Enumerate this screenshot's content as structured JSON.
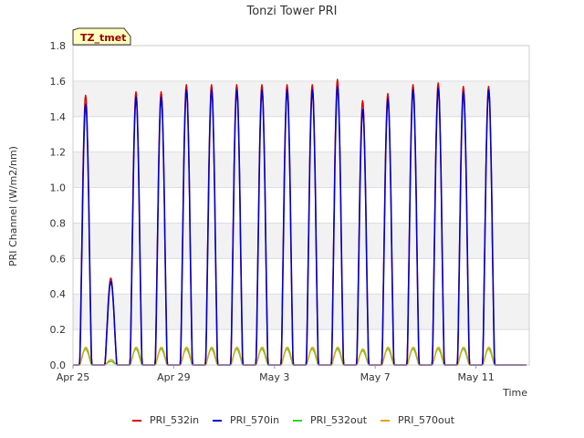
{
  "chart_data": {
    "type": "line",
    "title": "Tonzi Tower PRI",
    "xlabel": "Time",
    "ylabel": "PRI Channel (W/m2/nm)",
    "badge": "TZ_tmet",
    "ylim": [
      0,
      1.8
    ],
    "y_ticks": [
      "0.0",
      "0.2",
      "0.4",
      "0.6",
      "0.8",
      "1.0",
      "1.2",
      "1.4",
      "1.6",
      "1.8"
    ],
    "x_ticks": [
      "Apr 25",
      "Apr 29",
      "May 3",
      "May 7",
      "May 11"
    ],
    "x_start": "2024-04-25",
    "x_end": "2024-05-13",
    "legend_position": "bottom",
    "colors": {
      "PRI_532in": "#dd0000",
      "PRI_570in": "#0000cc",
      "PRI_532out": "#22dd22",
      "PRI_570out": "#e8a000"
    },
    "series": [
      {
        "name": "PRI_532in",
        "daily_peak": [
          1.52,
          0.49,
          1.54,
          1.54,
          1.58,
          1.58,
          1.58,
          1.58,
          1.58,
          1.58,
          1.61,
          1.49,
          1.53,
          1.58,
          1.59,
          1.57,
          1.57
        ]
      },
      {
        "name": "PRI_570in",
        "daily_peak": [
          1.47,
          0.47,
          1.51,
          1.51,
          1.55,
          1.55,
          1.55,
          1.55,
          1.55,
          1.55,
          1.57,
          1.44,
          1.5,
          1.55,
          1.56,
          1.54,
          1.55
        ]
      },
      {
        "name": "PRI_532out",
        "daily_peak": [
          0.09,
          0.02,
          0.09,
          0.09,
          0.09,
          0.09,
          0.09,
          0.09,
          0.09,
          0.09,
          0.09,
          0.08,
          0.09,
          0.09,
          0.09,
          0.09,
          0.09
        ]
      },
      {
        "name": "PRI_570out",
        "daily_peak": [
          0.1,
          0.03,
          0.1,
          0.1,
          0.1,
          0.1,
          0.1,
          0.1,
          0.1,
          0.1,
          0.1,
          0.09,
          0.1,
          0.1,
          0.1,
          0.1,
          0.1
        ]
      }
    ]
  }
}
